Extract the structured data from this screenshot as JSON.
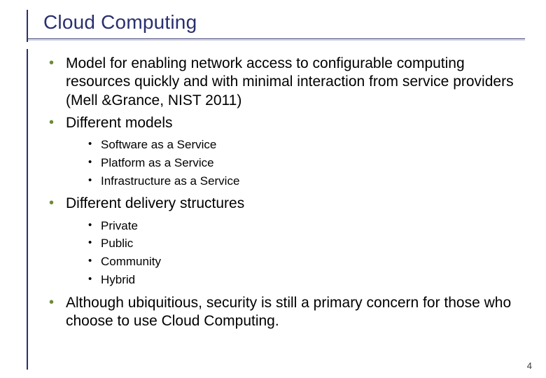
{
  "title": "Cloud Computing",
  "bullets": {
    "b1": "Model for enabling network access to configurable computing resources quickly and with minimal interaction from service providers (Mell &Grance, NIST 2011)",
    "b2": "Different models",
    "b2_sub": {
      "s1": "Software as a Service",
      "s2": "Platform as a Service",
      "s3": "Infrastructure as a Service"
    },
    "b3": "Different delivery structures",
    "b3_sub": {
      "s1": "Private",
      "s2": "Public",
      "s3": "Community",
      "s4": "Hybrid"
    },
    "b4": "Although ubiquitious, security is still a primary concern for those who choose to use Cloud Computing."
  },
  "page_number": "4"
}
